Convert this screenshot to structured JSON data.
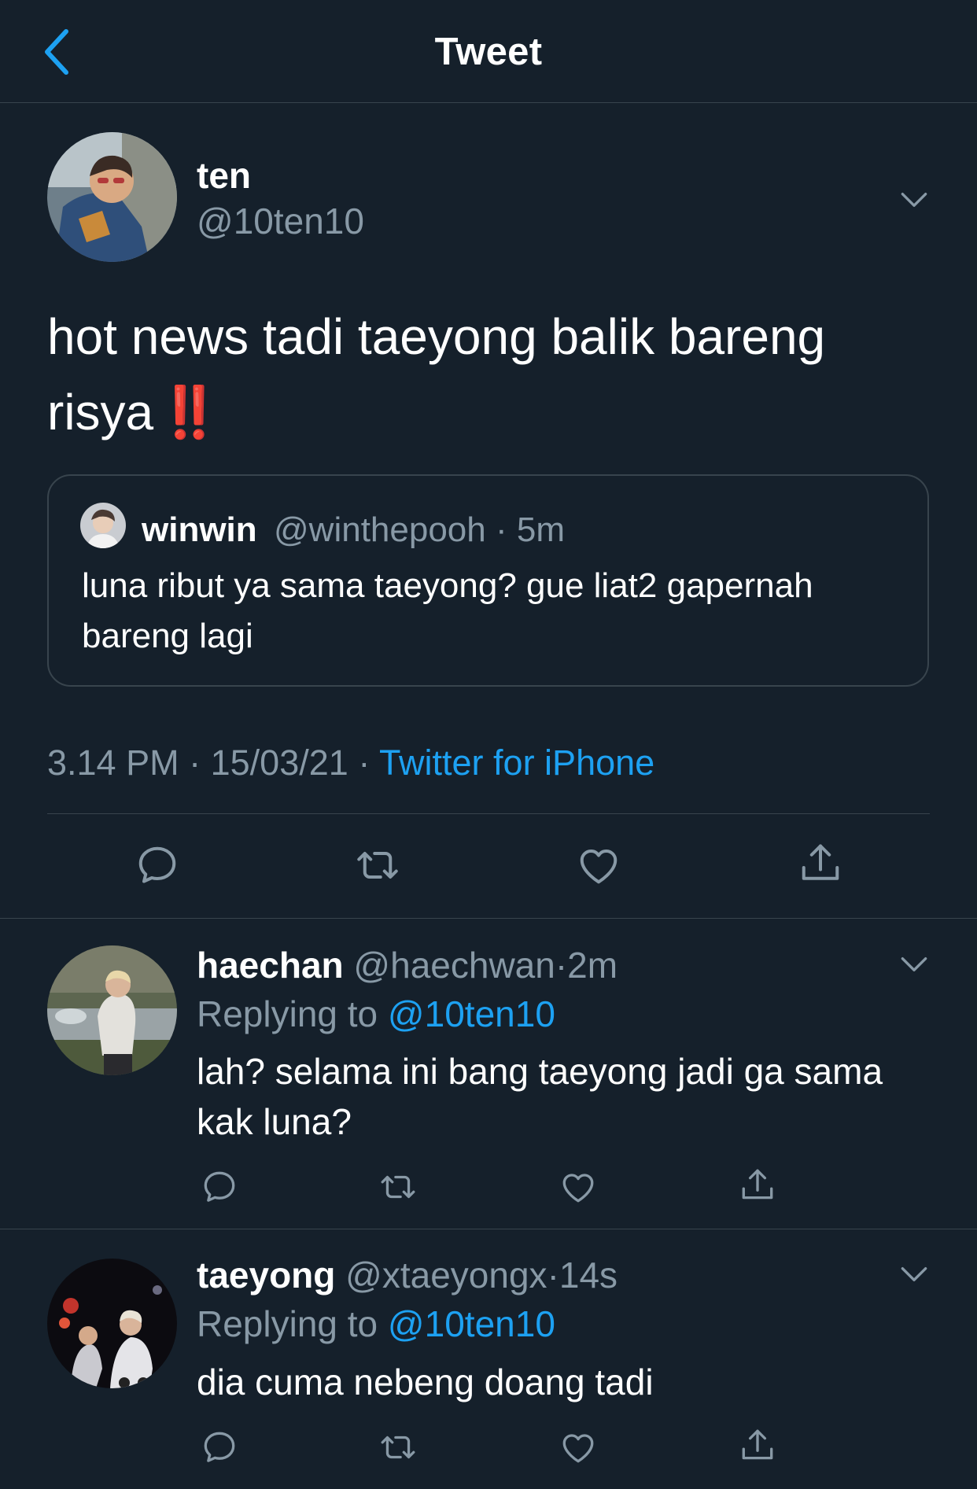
{
  "header": {
    "title": "Tweet"
  },
  "colors": {
    "background": "#15202b",
    "accent": "#1da1f2",
    "secondary_text": "#8899a6",
    "divider": "#38444d"
  },
  "tweet": {
    "author": {
      "name": "ten",
      "handle": "@10ten10"
    },
    "text": "hot news tadi taeyong balik bareng risya",
    "emoji": "‼️",
    "quote": {
      "name": "winwin",
      "handle": "@winthepooh",
      "separator": "·",
      "time": "5m",
      "text": "luna ribut ya sama taeyong? gue liat2 gapernah bareng lagi"
    },
    "time": "3.14 PM",
    "date": "15/03/21",
    "separator": "·",
    "source": "Twitter for iPhone"
  },
  "actions": [
    "reply-icon",
    "retweet-icon",
    "like-icon",
    "share-icon"
  ],
  "replies": [
    {
      "name": "haechan",
      "handle": "@haechwan",
      "separator": "·",
      "time": "2m",
      "replying_label": "Replying to",
      "replying_to": "@10ten10",
      "text": "lah? selama ini bang taeyong jadi ga sama kak luna?"
    },
    {
      "name": "taeyong",
      "handle": "@xtaeyongx",
      "separator": "·",
      "time": "14s",
      "replying_label": "Replying to",
      "replying_to": "@10ten10",
      "text": "dia cuma nebeng doang tadi"
    }
  ]
}
